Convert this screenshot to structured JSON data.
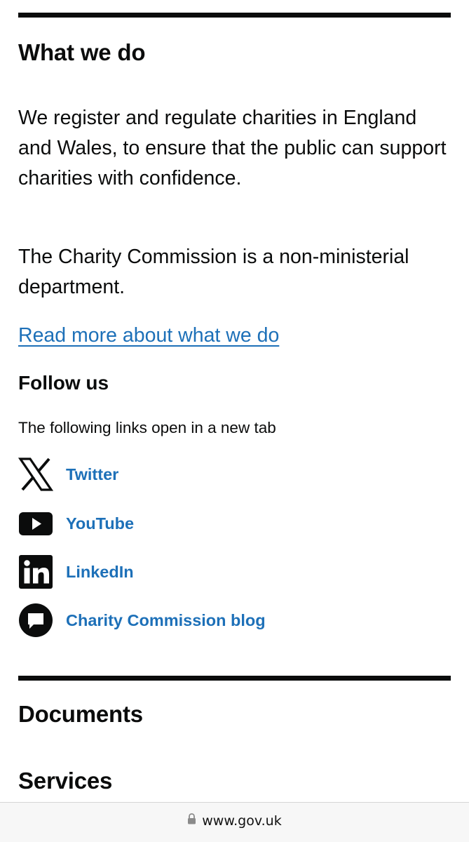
{
  "what_we_do": {
    "heading": "What we do",
    "paragraphs": [
      "We register and regulate charities in England and Wales, to ensure that the public can support charities with confidence.",
      "The Charity Commission is a non-ministerial department."
    ],
    "read_more_link": "Read more about what we do"
  },
  "follow_us": {
    "heading": "Follow us",
    "note": "The following links open in a new tab",
    "links": [
      {
        "label": "Twitter",
        "icon": "x-logo-icon"
      },
      {
        "label": "YouTube",
        "icon": "youtube-icon"
      },
      {
        "label": "LinkedIn",
        "icon": "linkedin-icon"
      },
      {
        "label": "Charity Commission blog",
        "icon": "speech-bubble-icon"
      }
    ]
  },
  "sections": {
    "documents_heading": "Documents",
    "services_heading": "Services"
  },
  "browser": {
    "url": "www.gov.uk",
    "lock_icon": "lock-icon"
  },
  "colors": {
    "text": "#0b0c0c",
    "link": "#1d70b8",
    "rule": "#0b0c0c",
    "browser_bar": "#f7f7f7"
  }
}
